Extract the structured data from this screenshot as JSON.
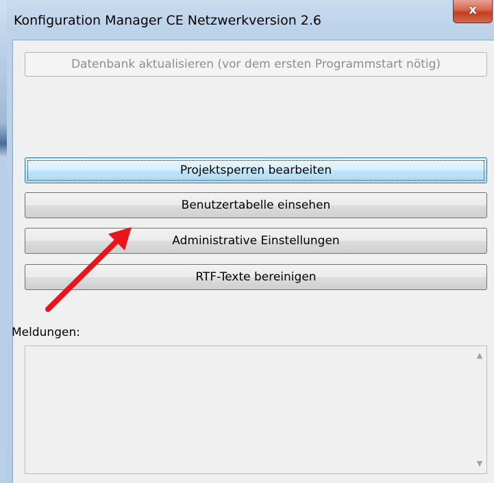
{
  "window": {
    "title": "Konfiguration Manager CE Netzwerkversion 2.6",
    "close_symbol": "x"
  },
  "buttons": {
    "update_db": "Datenbank aktualisieren (vor dem ersten Programmstart nötig)",
    "project_locks": "Projektsperren bearbeiten",
    "user_table": "Benutzertabelle einsehen",
    "admin_settings": "Administrative Einstellungen",
    "rtf_cleanup": "RTF-Texte bereinigen"
  },
  "messages": {
    "label": "Meldungen:",
    "content": ""
  },
  "icons": {
    "close": "close-icon",
    "scroll_up": "scroll-up-icon",
    "scroll_down": "scroll-down-icon",
    "annotation": "red-arrow-icon"
  },
  "colors": {
    "annotation_arrow": "#e8161c",
    "focus_border": "#3c7fb1"
  }
}
